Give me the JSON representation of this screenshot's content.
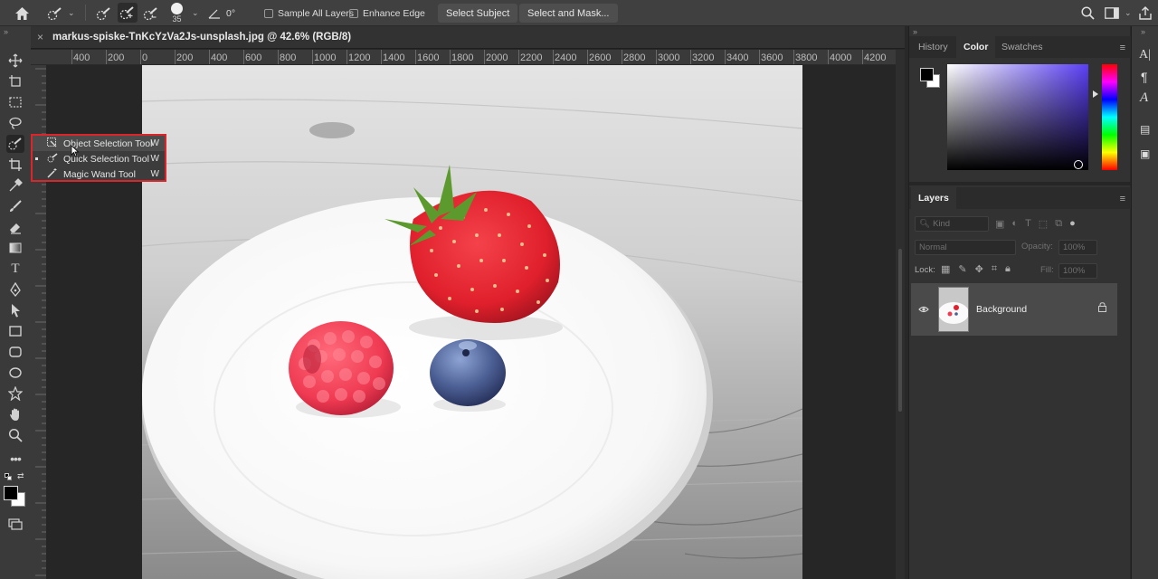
{
  "options_bar": {
    "brush_size": "35",
    "angle": "0°",
    "sample_all_layers": "Sample All Layers",
    "enhance_edge": "Enhance Edge",
    "select_subject": "Select Subject",
    "select_and_mask": "Select and Mask..."
  },
  "document": {
    "close": "×",
    "tab_title": "markus-spiske-TnKcYzVa2Js-unsplash.jpg @ 42.6% (RGB/8)",
    "ruler_labels": [
      "400",
      "200",
      "0",
      "200",
      "400",
      "600",
      "800",
      "1000",
      "1200",
      "1400",
      "1600",
      "1800",
      "2000",
      "2200",
      "2400",
      "2600",
      "2800",
      "3000",
      "3200",
      "3400",
      "3600",
      "3800",
      "4000",
      "4200"
    ]
  },
  "flyout": {
    "items": [
      {
        "label": "Object Selection Tool",
        "key": "W"
      },
      {
        "label": "Quick Selection Tool",
        "key": "W"
      },
      {
        "label": "Magic Wand Tool",
        "key": "W"
      }
    ]
  },
  "color_panel": {
    "tabs": [
      "History",
      "Color",
      "Swatches"
    ],
    "active_tab": "Color",
    "foreground": "#000000",
    "background": "#ffffff",
    "hue_color": "#5a3ff5"
  },
  "layers_panel": {
    "tab": "Layers",
    "search_placeholder": "Kind",
    "blend_mode": "Normal",
    "opacity_label": "Opacity:",
    "opacity_value": "100%",
    "lock_label": "Lock:",
    "fill_label": "Fill:",
    "fill_value": "100%",
    "layer_name": "Background"
  },
  "accent": "#d9252b"
}
